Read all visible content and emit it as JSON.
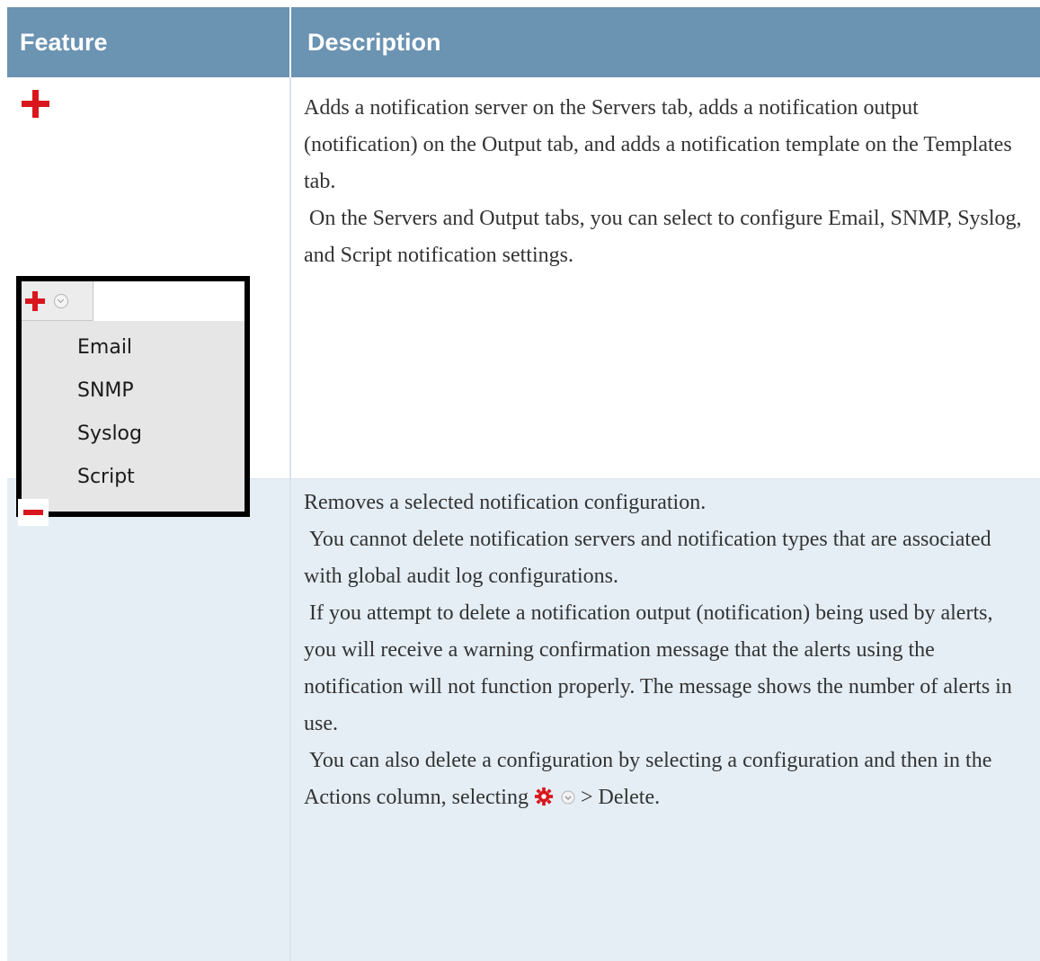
{
  "table": {
    "headers": {
      "feature": "Feature",
      "description": "Description"
    },
    "rows": [
      {
        "feature_icon": "plus-icon",
        "dropdown": {
          "button_icon": "plus-icon",
          "toggle_icon": "chevron-down-icon",
          "items": [
            "Email",
            "SNMP",
            "Syslog",
            "Script"
          ]
        },
        "paragraphs": [
          "Adds a notification server on the Servers tab, adds a notification output (notification) on the Output tab, and adds a notification template on the Templates tab.",
          " On the Servers and Output tabs, you can select to configure Email, SNMP, Syslog, and Script notification settings."
        ]
      },
      {
        "feature_icon": "minus-icon",
        "paragraphs": [
          "Removes a selected notification configuration.",
          " You cannot delete notification servers and notification types that are associated with global audit log configurations.",
          " If you attempt to delete a notification output (notification) being used by alerts, you will receive a warning confirmation message that the alerts using the notification will not function properly. The message shows the number of alerts in use."
        ],
        "last_paragraph": {
          "before_icon": " You can also delete a configuration by selecting a configuration and then in the Actions column, selecting ",
          "gear_icon": "gear-icon",
          "chevron_icon": "chevron-down-icon",
          "after_icon": " > Delete."
        }
      }
    ]
  },
  "colors": {
    "header_bg": "#6b93b2",
    "alt_row_bg": "#e5eef5",
    "icon_red": "#d9161d"
  }
}
